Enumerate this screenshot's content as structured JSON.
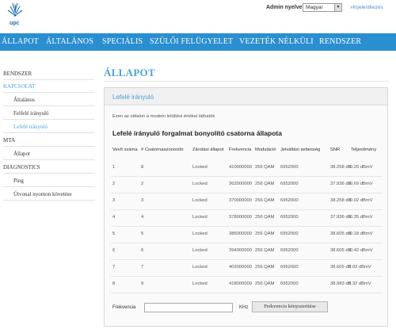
{
  "header": {
    "logo_text": "upc",
    "admin_lang_label": "Admin nyelve",
    "lang_value": "Magyar",
    "logout": "»Kijelentkezés"
  },
  "nav": [
    "ÁLLAPOT",
    "ÁLTALÁNOS",
    "SPECIÁLIS",
    "SZÜLŐI FELÜGYELET",
    "VEZETÉK NÉLKÜLI",
    "RENDSZER"
  ],
  "sidebar": {
    "items": [
      {
        "label": "RENDSZER",
        "active": false
      },
      {
        "label": "KAPCSOLAT",
        "active": true
      },
      {
        "label": "Általános",
        "active": false
      },
      {
        "label": "Felfelé irányuló",
        "active": false
      },
      {
        "label": "Lefelé irányuló",
        "active": true
      },
      {
        "label": "MTA",
        "active": false
      },
      {
        "label": "Állapot",
        "active": false
      },
      {
        "label": "DIAGNOSTICS",
        "active": false
      },
      {
        "label": "Ping",
        "active": false
      },
      {
        "label": "Útvonal nyomon követése",
        "active": false
      }
    ]
  },
  "main": {
    "title": "ÁLLAPOT",
    "panel_title": "Lefelé irányuló",
    "description": "Ezen az oldalon a modem letöltési értékei láthatók",
    "section_heading": "Lefelé irányuló forgalmat bonyolító csatorna állapota",
    "columns": [
      "Vevő száma",
      "# Csatornaazonosító",
      "Zárolási állapot",
      "Frekvencia",
      "Moduláció",
      "Jelváltási sebesség",
      "SNR",
      "Teljesítmény"
    ],
    "rows": [
      [
        "1",
        "8",
        "Locked",
        "410000000",
        "256 QAM",
        "6952000",
        "38.258 dB",
        "-0.20 dBmV"
      ],
      [
        "2",
        "2",
        "Locked",
        "362000000",
        "256 QAM",
        "6952000",
        "37.936 dB",
        "-0.69 dBmV"
      ],
      [
        "3",
        "3",
        "Locked",
        "370000000",
        "256 QAM",
        "6952000",
        "38.258 dB",
        "-0.02 dBmV"
      ],
      [
        "4",
        "4",
        "Locked",
        "378000000",
        "256 QAM",
        "6952000",
        "37.936 dB",
        "-0.35 dBmV"
      ],
      [
        "5",
        "5",
        "Locked",
        "386000000",
        "256 QAM",
        "6952000",
        "38.605 dB",
        "-0.18 dBmV"
      ],
      [
        "6",
        "6",
        "Locked",
        "394000000",
        "256 QAM",
        "6952000",
        "38.605 dB",
        "-0.42 dBmV"
      ],
      [
        "7",
        "7",
        "Locked",
        "402000000",
        "256 QAM",
        "6952000",
        "38.605 dB",
        "0.03 dBmV"
      ],
      [
        "8",
        "9",
        "Locked",
        "418000000",
        "256 QAM",
        "6952000",
        "38.983 dB",
        "0.32 dBmV"
      ]
    ],
    "freq_label": "Frekvencia",
    "freq_value": "",
    "freq_unit": "KHz",
    "freq_button": "Frekvencia kényszerítése"
  },
  "colors": {
    "nav_bg": "#2a8fd0",
    "accent": "#4aa3d6"
  }
}
